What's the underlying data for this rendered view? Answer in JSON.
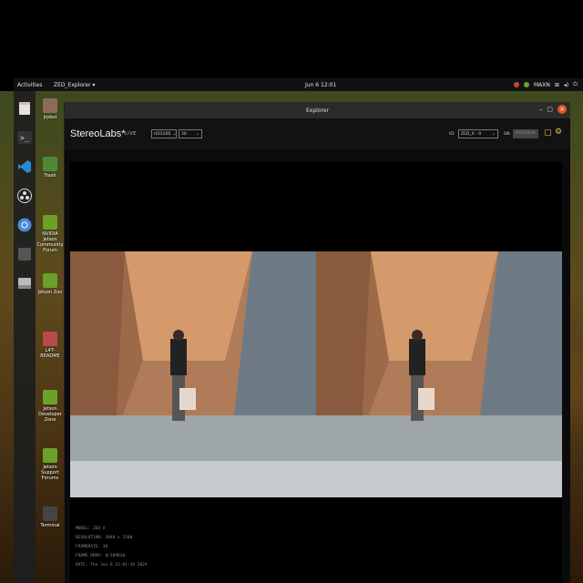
{
  "topbar": {
    "activities": "Activities",
    "app_menu": "ZED_Explorer ▾",
    "clock": "Jun 6 12:01",
    "power_mode": "MAXN"
  },
  "desktop": {
    "icons": [
      {
        "label": "jrpbot",
        "icon": "folder-icon",
        "color": "#8e6a5a"
      },
      {
        "label": "Trash",
        "icon": "trash-icon",
        "color": "#4c8a3a"
      },
      {
        "label": "NVIDIA Jetson Community Forum",
        "icon": "nvidia-link-icon",
        "color": "#6aa12a"
      },
      {
        "label": "Jetson Zoo",
        "icon": "nvidia-link-icon",
        "color": "#6aa12a"
      },
      {
        "label": "L4T-README",
        "icon": "drive-icon",
        "color": "#b84a4a"
      },
      {
        "label": "Jetson Developer Zone",
        "icon": "nvidia-link-icon",
        "color": "#6aa12a"
      },
      {
        "label": "Jetson Support Forums",
        "icon": "nvidia-link-icon",
        "color": "#6aa12a"
      },
      {
        "label": "Terminal",
        "icon": "terminal-icon",
        "color": "#444"
      }
    ]
  },
  "window": {
    "title": "Explorer",
    "minimize": "–",
    "maximize": "▢",
    "close": "×"
  },
  "app": {
    "brand": "StereoLabs*",
    "live_label": "LIVE",
    "resolution_select": "HD1200",
    "fps_select": "30",
    "id_label": "ID:",
    "id_select": "ZED_X - 0",
    "sn_label": "SN:",
    "sn_value": "40020836"
  },
  "camera_info": {
    "model": "MODEL: ZED X",
    "resolution": "RESOLUTION: 3840 x 1200",
    "framerate": "FRAMERATE: 30",
    "frame_drop": "FRAME DROP: 0/109838",
    "date": "DATE: Thu Jun 6 12:01:34 2024"
  }
}
